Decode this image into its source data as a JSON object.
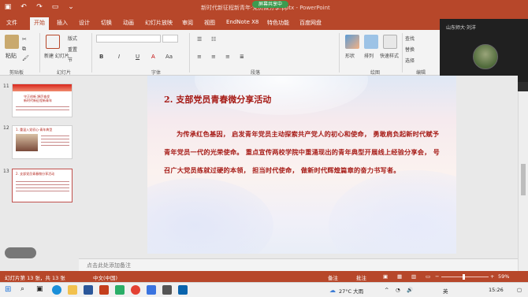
{
  "app": {
    "title": "新时代新征程新青年·党员微分享.pptx - PowerPoint",
    "share_indicator": "屏幕共享中"
  },
  "quick_access": [
    "save",
    "undo",
    "redo",
    "present",
    "more"
  ],
  "tabs": [
    "文件",
    "开始",
    "插入",
    "设计",
    "切换",
    "动画",
    "幻灯片放映",
    "审阅",
    "视图",
    "EndNote X8",
    "特色功能",
    "百度网盘"
  ],
  "active_tab": "开始",
  "ribbon": {
    "paste": "粘贴",
    "new_slide": "新建\n幻灯片",
    "layout": "版式",
    "reset": "重置",
    "section": "节",
    "groups": [
      "剪贴板",
      "幻灯片",
      "字体",
      "段落",
      "绘图",
      "编辑"
    ],
    "font_name": "",
    "font_size": "",
    "bold": "B",
    "italic": "I",
    "underline": "U",
    "shape": "形状",
    "arrange": "排列",
    "quick_styles": "快速样式",
    "find": "查找",
    "replace": "替换",
    "select": "选择"
  },
  "video_call": {
    "participant": "山东师大·刘洋",
    "speaker": "龙阿"
  },
  "thumbnails": [
    {
      "num": "11",
      "title": "守正创新 踔厉奋发\n新时代新征程新青年",
      "selected": false
    },
    {
      "num": "12",
      "title": "1. 重温入党初心·青年典型",
      "selected": false
    },
    {
      "num": "13",
      "title": "2. 支部党员青春微分享活动",
      "selected": true
    }
  ],
  "slide": {
    "title": "2. 支部党员青春微分享活动",
    "body": "为传承红色基因， 启发青年党员主动探索共产党人的初心和使命， 勇敢肩负起新时代赋予青年党员一代的光荣使命。 重点宣传两校学院中重涌现出的青年典型开展线上经验分享会， 号召广大党员练就过硬的本领， 担当时代使命， 做新时代辉煌篇章的奋力书写者。"
  },
  "notes_placeholder": "点击此处添加备注",
  "status": {
    "slide_info": "幻灯片第 13 张，共 13 张",
    "language": "中文(中国)",
    "notes": "备注",
    "comments": "批注",
    "zoom": "59%"
  },
  "taskbar": {
    "weather": "27°C 大雨",
    "ime": "英",
    "time": "15:26",
    "date": "",
    "search_text": "",
    "apps": [
      "start",
      "search",
      "task-view",
      "edge",
      "explorer",
      "word",
      "powerpoint",
      "wechat",
      "chrome",
      "meeting",
      "store",
      "mail"
    ]
  },
  "colors": {
    "accent": "#b7472a",
    "slide_text": "#a61b16"
  }
}
